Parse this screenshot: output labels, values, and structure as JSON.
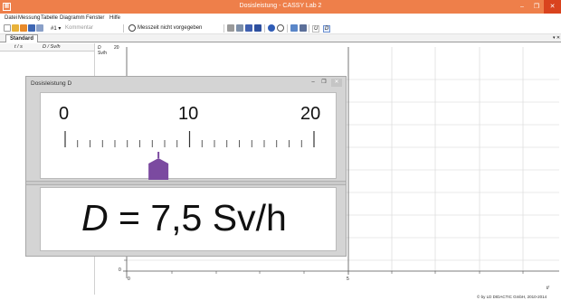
{
  "window": {
    "title": "Dosisleistung - CASSY Lab 2",
    "app_icon": "cassy-app-icon",
    "controls": {
      "minimize": "–",
      "maximize": "❐",
      "close": "✕"
    }
  },
  "menu": [
    {
      "label": "Datei"
    },
    {
      "label": "Messung"
    },
    {
      "label": "Tabelle"
    },
    {
      "label": "Diagramm"
    },
    {
      "label": "Fenster"
    },
    {
      "label": "Hilfe"
    }
  ],
  "toolbar": {
    "counter": "#1 ▾",
    "comment_placeholder": "Kommentar",
    "measure_time": "Messzeit nicht vorgegeben",
    "unit_buttons": [
      "U",
      "D"
    ]
  },
  "tabs": {
    "active": "Standard"
  },
  "table": {
    "col_t": "t / s",
    "col_D": "D / Sv/h"
  },
  "diagram": {
    "y_symbol": "D",
    "y_unit": "Sv/h",
    "y_top": "20",
    "y_zero": "0",
    "x_zero": "0",
    "x_five": "5",
    "x_unit": "t/",
    "copyright": "© by LD DIDACTIC GmbH, 2010-2014"
  },
  "display": {
    "title": "Dosisleistung D",
    "controls": {
      "minimize": "–",
      "maximize": "❐",
      "close": "✕"
    },
    "scale_labels": [
      "0",
      "10",
      "20"
    ],
    "scale": {
      "min": 0,
      "max": 20,
      "value": 7.5
    },
    "indicator_color": "#7b4aa0",
    "readout": {
      "symbol": "D",
      "eq": " = ",
      "value": "7,5",
      "unit": "Sv/h"
    }
  }
}
